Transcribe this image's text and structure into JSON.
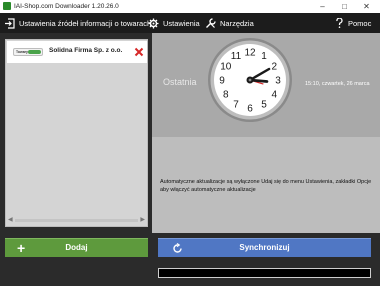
{
  "window": {
    "title": "IAI-Shop.com Downloader 1.20.26.0"
  },
  "toolbar": {
    "sources_label": "Ustawienia źródeł informacji o towarach",
    "settings_label": "Ustawienia",
    "tools_label": "Narzędzia",
    "help_label": "Pomoc"
  },
  "sources": {
    "items": [
      {
        "logo_text": "Towary",
        "name": "Solidna Firma Sp. z o.o."
      }
    ]
  },
  "status": {
    "last_label": "Ostatnia",
    "last_run": "15:10, czwartek, 26 marca",
    "info": "Automatyczne aktualizacje są wyłączone Udaj się do menu Ustawienia, zakładki Opcje aby włączyć automatyczne aktualizacje"
  },
  "clock": {
    "numbers": [
      "12",
      "1",
      "2",
      "3",
      "4",
      "5",
      "6",
      "7",
      "8",
      "9",
      "10",
      "11"
    ],
    "hour": 3,
    "minute": 10
  },
  "actions": {
    "add_label": "Dodaj",
    "sync_label": "Synchronizuj"
  },
  "colors": {
    "add": "#5e9a3d",
    "sync": "#5077c4",
    "toolbar": "#1c1c1c",
    "delete": "#d62828"
  }
}
